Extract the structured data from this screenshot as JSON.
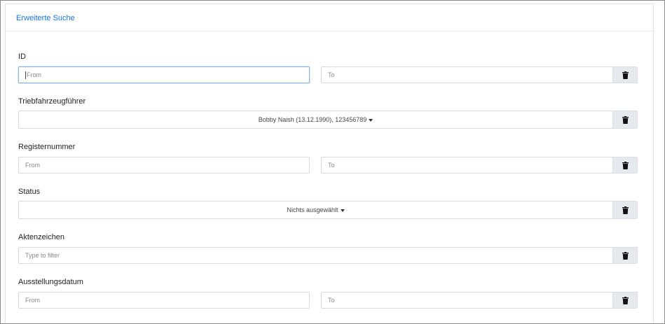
{
  "panel": {
    "title": "Erweiterte Suche"
  },
  "fields": {
    "id": {
      "label": "ID",
      "from_placeholder": "From",
      "to_placeholder": "To"
    },
    "driver": {
      "label": "Triebfahrzeugführer",
      "selected": "Bobby Naish (13.12.1990), 123456789"
    },
    "register": {
      "label": "Registernummer",
      "from_placeholder": "From",
      "to_placeholder": "To"
    },
    "status": {
      "label": "Status",
      "selected": "Nichts ausgewählt"
    },
    "file_ref": {
      "label": "Aktenzeichen",
      "placeholder": "Type to filter"
    },
    "issue_date": {
      "label": "Ausstellungsdatum",
      "from_placeholder": "From",
      "to_placeholder": "To"
    }
  },
  "icons": {
    "delete": "trash-icon",
    "dropdown": "caret-down-icon"
  },
  "colors": {
    "accent": "#1a73e8",
    "button_bg": "#e6e9ee",
    "focus_border": "#8ab4d8"
  }
}
